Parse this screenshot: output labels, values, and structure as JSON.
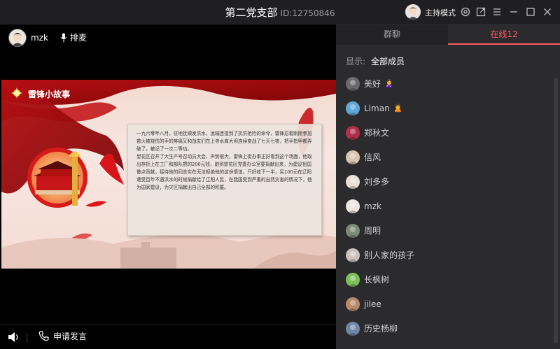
{
  "window": {
    "title": "第二党支部",
    "room_id": "ID:12750846",
    "host_mode_label": "主持模式",
    "icons": [
      "settings-icon",
      "external-link-icon",
      "menu-icon",
      "minimize-icon",
      "maximize-icon",
      "close-icon"
    ]
  },
  "stage": {
    "presenter_name": "mzk",
    "mic_button_label": "排麦",
    "apply_speak_label": "申请发言",
    "slide": {
      "heading": "雷锋小故事",
      "paragraphs": [
        "一九六零年八月，驻地抚顺发洪水，运输连接到了抗洪抢险的命令，雷锋忍着刚刚参加救火被烧伤的手的疼痛又和战友们在上寺水库大坝连续奋战了七天七夜，把手指甲都弄破了，被记了一次二等功。",
        "望花区召开了大生产号召动员大会，声势很大，雷锋上街办事正好看到这个场面，他取出存折上在工厂和部队攒的200元钱，跑到望花区党委办公室要捐献出来，为建设祖国做点贡献，接待他的同志实在无法拒绝他的这份情谊，只好收下一半，另100元在辽阳遭受百年不遇洪水的时候捐献给了辽阳人民，在我国受到严重的自然灾害的情况下，他为国家建设，为灾区捐献出自己全部的积蓄。"
      ]
    }
  },
  "panel": {
    "tabs": [
      {
        "label": "群聊"
      },
      {
        "label": "在线12"
      }
    ],
    "filter_label": "显示:",
    "filter_value": "全部成员",
    "members": [
      {
        "name": "美好",
        "badge": "🙎‍♀️",
        "avatar_color": "#6b6b6b"
      },
      {
        "name": "Liman",
        "badge": "🙎",
        "avatar_color": "#5fa8d8"
      },
      {
        "name": "郑秋文",
        "badge": "",
        "avatar_color": "#b0304a"
      },
      {
        "name": "信风",
        "badge": "",
        "avatar_color": "#d9c3b1"
      },
      {
        "name": "刘多多",
        "badge": "",
        "avatar_color": "#e8dfd6"
      },
      {
        "name": "mzk",
        "badge": "",
        "avatar_color": "#ece6e0"
      },
      {
        "name": "周明",
        "badge": "",
        "avatar_color": "#7a8b76"
      },
      {
        "name": "别人家的孩子",
        "badge": "",
        "avatar_color": "#c9c3bc"
      },
      {
        "name": "长枫树",
        "badge": "",
        "avatar_color": "#7bbf57"
      },
      {
        "name": "jilee",
        "badge": "",
        "avatar_color": "#b88a6c"
      },
      {
        "name": "历史杨柳",
        "badge": "",
        "avatar_color": "#6f87a8"
      }
    ]
  }
}
